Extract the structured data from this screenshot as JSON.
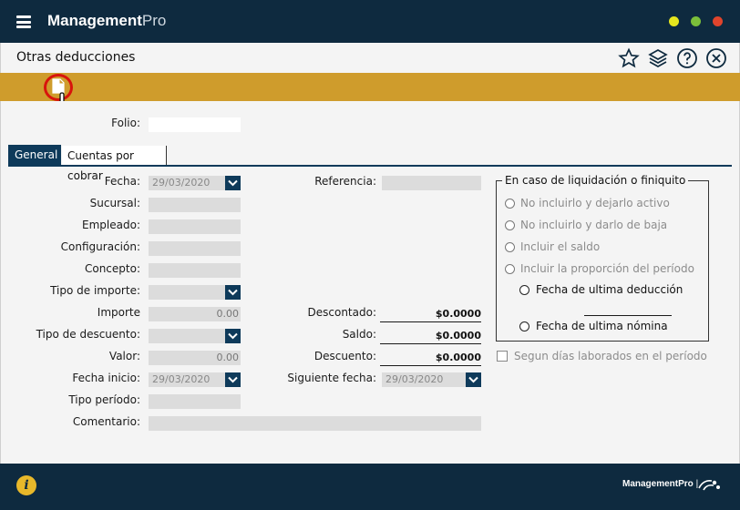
{
  "app": {
    "brand_bold": "Management",
    "brand_light": "Pro",
    "footer_brand_bold": "ManagementPro",
    "footer_brand_suffix": "|",
    "info_glyph": "i"
  },
  "header": {
    "title": "Otras deducciones"
  },
  "toolbar": {
    "new_icon": "new-document-icon"
  },
  "form": {
    "folio_label": "Folio:",
    "folio_value": ""
  },
  "tabs": [
    {
      "label": "General",
      "active": true
    },
    {
      "label": "Cuentas por cobrar",
      "active": false
    }
  ],
  "left": {
    "fecha_label": "Fecha:",
    "fecha_value": "29/03/2020",
    "sucursal_label": "Sucursal:",
    "empleado_label": "Empleado:",
    "configuracion_label": "Configuración:",
    "concepto_label": "Concepto:",
    "tipo_importe_label": "Tipo de importe:",
    "importe_label": "Importe",
    "importe_value": "0.00",
    "tipo_descuento_label": "Tipo de descuento:",
    "valor_label": "Valor:",
    "valor_value": "0.00",
    "fecha_inicio_label": "Fecha inicio:",
    "fecha_inicio_value": "29/03/2020",
    "tipo_periodo_label": "Tipo período:",
    "comentario_label": "Comentario:"
  },
  "middle": {
    "referencia_label": "Referencia:",
    "descontado_label": "Descontado:",
    "descontado_value": "$0.0000",
    "saldo_label": "Saldo:",
    "saldo_value": "$0.0000",
    "descuento_label": "Descuento:",
    "descuento_value": "$0.0000",
    "siguiente_fecha_label": "Siguiente fecha:",
    "siguiente_fecha_value": "29/03/2020"
  },
  "liquidacion": {
    "title": "En caso de liquidación o finiquito",
    "options": [
      "No incluirlo y dejarlo activo",
      "No incluirlo y darlo de baja",
      "Incluir el saldo",
      "Incluir la proporción del período"
    ],
    "sub_options": [
      "Fecha de ultima deducción",
      "Fecha de ultima nómina"
    ]
  },
  "checkbox": {
    "label": "Segun días laborados en el período",
    "checked": false
  },
  "colors": {
    "titlebar": "#0e2a3f",
    "toolbar": "#cf9c2c",
    "accent": "#0e3a5a",
    "highlight_ring": "#d8140c"
  }
}
